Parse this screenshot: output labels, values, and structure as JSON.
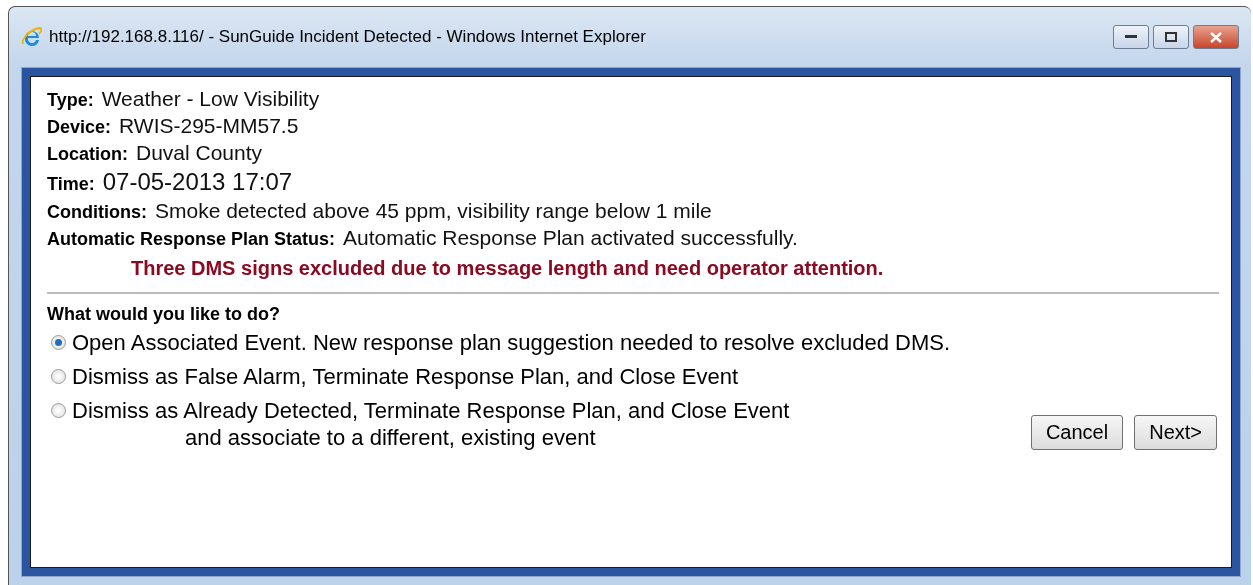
{
  "window": {
    "title": "http://192.168.8.116/ - SunGuide Incident Detected - Windows Internet Explorer"
  },
  "details": [
    {
      "label": "Type:",
      "value": "Weather - Low Visibility"
    },
    {
      "label": "Device:",
      "value": "RWIS-295-MM57.5"
    },
    {
      "label": "Location:",
      "value": "Duval County"
    },
    {
      "label": "Time:",
      "value": "07-05-2013 17:07"
    },
    {
      "label": "Conditions:",
      "value": "Smoke detected above 45 ppm, visibility range below 1 mile"
    },
    {
      "label": "Automatic Response Plan Status:",
      "value": "Automatic Response Plan activated successfully."
    }
  ],
  "warning": "Three DMS signs excluded due to message length and need operator attention.",
  "question": "What would you like to do?",
  "options": [
    {
      "lines": [
        "Open Associated Event. New response plan suggestion needed to resolve excluded DMS."
      ],
      "selected": true
    },
    {
      "lines": [
        "Dismiss as False Alarm, Terminate Response Plan, and Close Event"
      ],
      "selected": false
    },
    {
      "lines": [
        "Dismiss as Already Detected, Terminate Response Plan, and Close Event",
        "and associate to a different, existing event"
      ],
      "selected": false
    }
  ],
  "buttons": [
    "Cancel",
    "Next>"
  ]
}
